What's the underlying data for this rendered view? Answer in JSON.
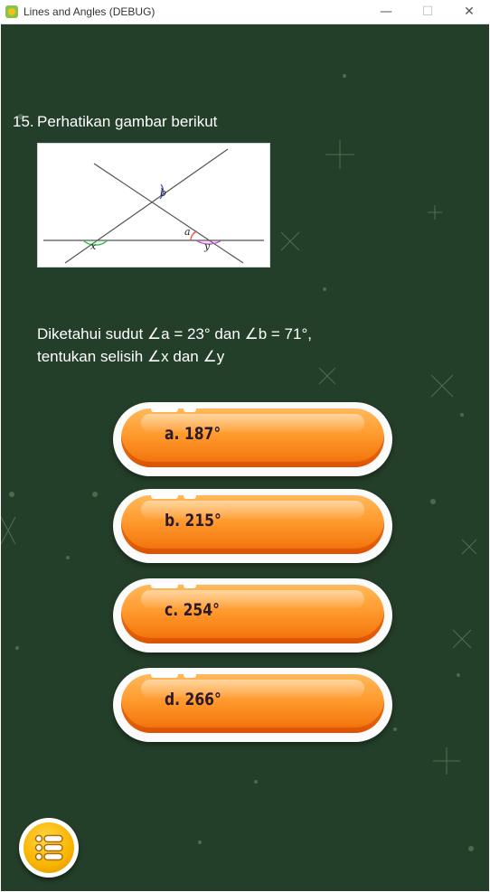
{
  "window": {
    "title": "Lines and Angles (DEBUG)",
    "minimize": "—",
    "maximize": "☐",
    "close": "✕"
  },
  "question": {
    "number": "15.",
    "title": "Perhatikan gambar berikut",
    "line1": "Diketahui sudut  ∠a = 23° dan  ∠b = 71°,",
    "line2": "tentukan selisih  ∠x dan  ∠y"
  },
  "figure": {
    "labels": {
      "b": "b",
      "a": "a",
      "x": "x",
      "y": "y"
    }
  },
  "options": [
    {
      "label": "a. 187°"
    },
    {
      "label": "b. 215°"
    },
    {
      "label": "c. 254°"
    },
    {
      "label": "d. 266°"
    }
  ],
  "colors": {
    "background": "#233e29",
    "option": "#ff9a2e",
    "menu": "#f8b400"
  },
  "icons": {
    "menu": "list-icon",
    "app": "app-icon"
  }
}
